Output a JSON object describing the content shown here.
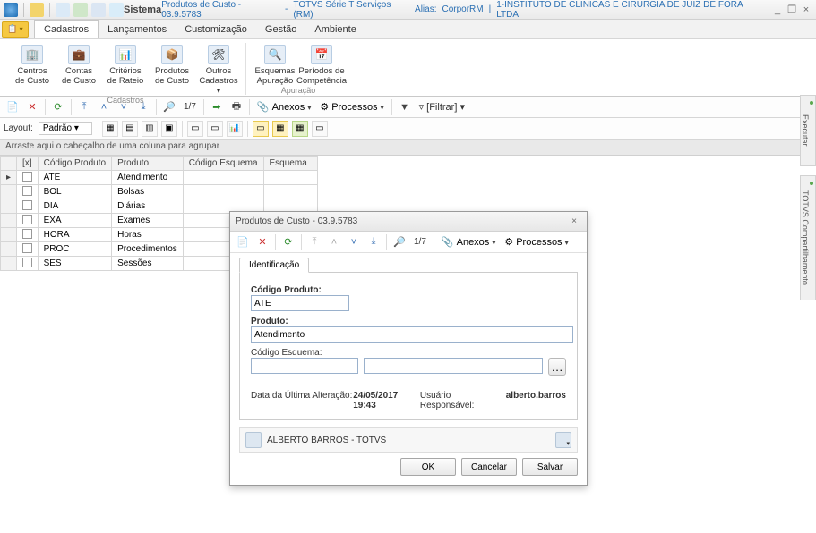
{
  "titlebar": {
    "system_label": "Sistema",
    "product": "Produtos de Custo - 03.9.5783",
    "suite": "TOTVS Série T Serviços (RM)",
    "alias_label": "Alias:",
    "alias": "CorporRM",
    "company": "1-INSTITUTO DE CLINICAS E CIRURGIA DE JUIZ DE FORA LTDA",
    "minimize": "_",
    "restore": "❐",
    "close": "×"
  },
  "menus": {
    "cadastros": "Cadastros",
    "lancamentos": "Lançamentos",
    "customizacao": "Customização",
    "gestao": "Gestão",
    "ambiente": "Ambiente"
  },
  "ribbon": {
    "centros_custo": "Centros\nde Custo",
    "contas_custo": "Contas\nde Custo",
    "criterios_rateio": "Critérios\nde Rateio",
    "produtos_custo": "Produtos\nde Custo",
    "outros_cadastros": "Outros\nCadastros ▾",
    "group_cadastros": "Cadastros",
    "esquemas_apuracao": "Esquemas\nApuração",
    "periodos_competencia": "Períodos de\nCompetência",
    "group_apuracao": "Apuração"
  },
  "toolbar": {
    "count": "1/7",
    "anexos": "Anexos",
    "processos": "Processos",
    "filtrar": "[Filtrar]"
  },
  "toolbar2": {
    "layout_label": "Layout:",
    "layout_value": "Padrão ▾"
  },
  "grid": {
    "group_hint": "Arraste aqui o cabeçalho de uma coluna para agrupar",
    "col_x": "[x]",
    "col_codigo": "Código Produto",
    "col_produto": "Produto",
    "col_codigo_esquema": "Código Esquema",
    "col_esquema": "Esquema",
    "rows": [
      {
        "codigo": "ATE",
        "produto": "Atendimento"
      },
      {
        "codigo": "BOL",
        "produto": "Bolsas"
      },
      {
        "codigo": "DIA",
        "produto": "Diárias"
      },
      {
        "codigo": "EXA",
        "produto": "Exames"
      },
      {
        "codigo": "HORA",
        "produto": "Horas"
      },
      {
        "codigo": "PROC",
        "produto": "Procedimentos"
      },
      {
        "codigo": "SES",
        "produto": "Sessões"
      }
    ]
  },
  "side": {
    "executar": "Executar",
    "compart": "TOTVS Compartilhamento"
  },
  "dialog": {
    "title": "Produtos de Custo - 03.9.5783",
    "close": "×",
    "count": "1/7",
    "anexos": "Anexos",
    "processos": "Processos",
    "tab_ident": "Identificação",
    "label_codigo": "Código Produto:",
    "value_codigo": "ATE",
    "label_produto": "Produto:",
    "value_produto": "Atendimento",
    "label_codesq": "Código Esquema:",
    "meta_date_label": "Data da Última Alteração:",
    "meta_date": "24/05/2017 19:43",
    "meta_user_label": "Usuário Responsável:",
    "meta_user": "alberto.barros",
    "userbar": "ALBERTO BARROS - TOTVS",
    "btn_ok": "OK",
    "btn_cancel": "Cancelar",
    "btn_save": "Salvar"
  }
}
